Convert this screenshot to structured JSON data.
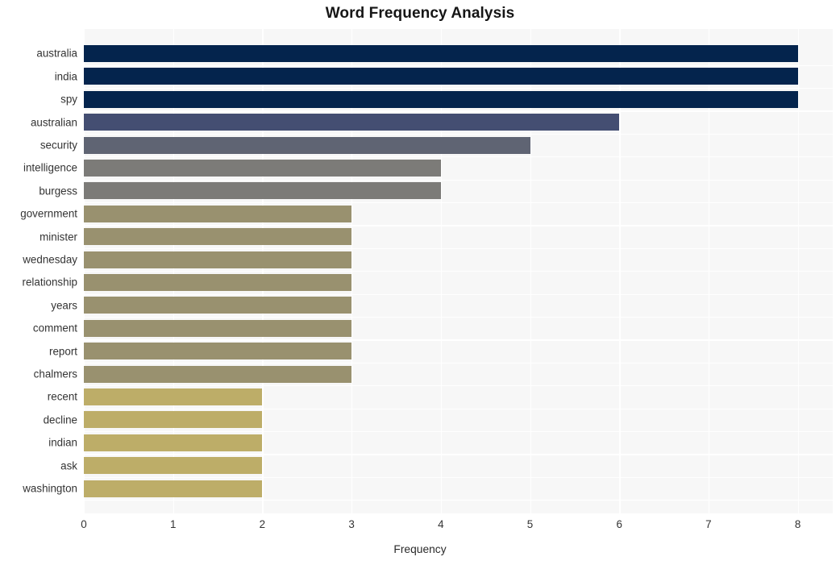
{
  "chart_data": {
    "type": "bar",
    "orientation": "horizontal",
    "title": "Word Frequency Analysis",
    "xlabel": "Frequency",
    "ylabel": "",
    "xlim": [
      0,
      8
    ],
    "xticks": [
      "0",
      "1",
      "2",
      "3",
      "4",
      "5",
      "6",
      "7",
      "8"
    ],
    "grid": true,
    "legend": "none",
    "categories": [
      "australia",
      "india",
      "spy",
      "australian",
      "security",
      "intelligence",
      "burgess",
      "government",
      "minister",
      "wednesday",
      "relationship",
      "years",
      "comment",
      "report",
      "chalmers",
      "recent",
      "decline",
      "indian",
      "ask",
      "washington"
    ],
    "values": [
      8,
      8,
      8,
      6,
      5,
      4,
      4,
      3,
      3,
      3,
      3,
      3,
      3,
      3,
      3,
      2,
      2,
      2,
      2,
      2
    ],
    "bar_colors": [
      "#04244d",
      "#04244d",
      "#04244d",
      "#444e72",
      "#5f6473",
      "#7c7b78",
      "#7c7b78",
      "#99916f",
      "#99916f",
      "#99916f",
      "#99916f",
      "#99916f",
      "#99916f",
      "#99916f",
      "#99916f",
      "#bdad68",
      "#bdad68",
      "#bdad68",
      "#bdad68",
      "#bdad68"
    ],
    "plot_background": "#f7f7f7",
    "gridline_color": "#ffffff",
    "figure_background": "#ffffff"
  }
}
